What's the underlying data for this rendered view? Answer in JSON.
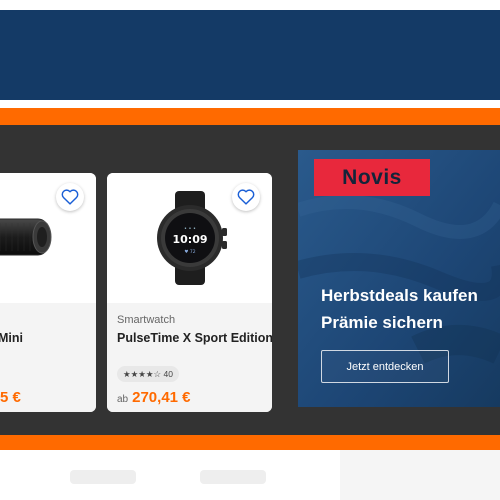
{
  "colors": {
    "header": "#143a66",
    "accent": "#ff6a00",
    "band": "#333333",
    "promo_bg": "#1e4b7a",
    "brand_box": "#e8283c",
    "heart": "#1a5fd6"
  },
  "products": [
    {
      "category": "",
      "title": "Mini",
      "rating_count": "",
      "price_prefix": "",
      "price": "5 €",
      "icon": "heart-icon"
    },
    {
      "category": "Smartwatch",
      "title": "PulseTime X Sport Edition",
      "rating_count": "★★★★☆ 40",
      "price_prefix": "ab",
      "price": "270,41 €",
      "icon": "heart-icon"
    }
  ],
  "promo": {
    "brand": "Novis",
    "line1": "Herbstdeals kaufen",
    "line2": "Prämie sichern",
    "cta": "Jetzt entdecken"
  }
}
